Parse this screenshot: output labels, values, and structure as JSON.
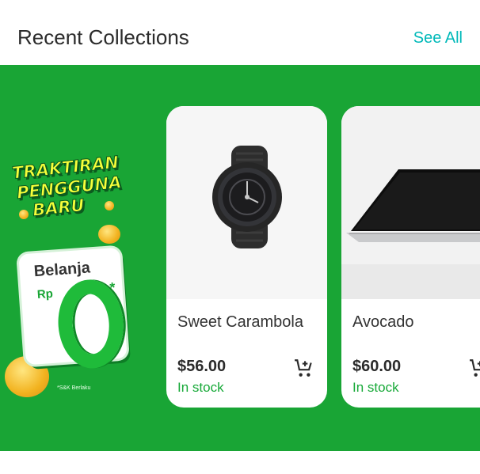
{
  "header": {
    "title": "Recent Collections",
    "see_all": "See All"
  },
  "promo": {
    "line1": "TRAKTIRAN",
    "line2": "PENGGUNA",
    "line3": "BARU",
    "card_label": "Belanja",
    "currency": "Rp",
    "asterisk": "*",
    "terms": "*S&K Berlaku"
  },
  "products": [
    {
      "name": "Sweet Carambola",
      "price": "$56.00",
      "stock": "In stock",
      "image": "smartwatch"
    },
    {
      "name": "Avocado",
      "price": "$60.00",
      "stock": "In stock",
      "image": "laptop"
    }
  ],
  "colors": {
    "brand_green": "#19a535",
    "accent_teal": "#00b9b9",
    "stock_green": "#17a938"
  }
}
